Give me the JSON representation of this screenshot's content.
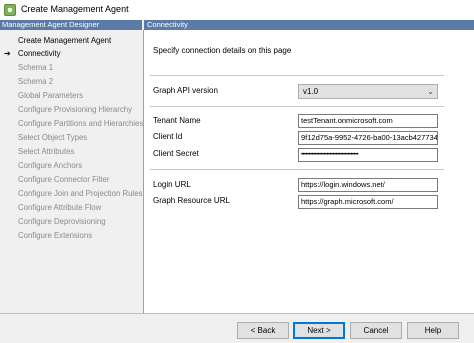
{
  "window": {
    "title": "Create Management Agent"
  },
  "sidebar": {
    "header": "Management Agent Designer",
    "items": [
      {
        "label": "Create Management Agent",
        "enabled": true,
        "current": false
      },
      {
        "label": "Connectivity",
        "enabled": true,
        "current": true
      },
      {
        "label": "Schema 1",
        "enabled": false,
        "current": false
      },
      {
        "label": "Schema 2",
        "enabled": false,
        "current": false
      },
      {
        "label": "Global Parameters",
        "enabled": false,
        "current": false
      },
      {
        "label": "Configure Provisioning Hierarchy",
        "enabled": false,
        "current": false
      },
      {
        "label": "Configure Partitions and Hierarchies",
        "enabled": false,
        "current": false
      },
      {
        "label": "Select Object Types",
        "enabled": false,
        "current": false
      },
      {
        "label": "Select Attributes",
        "enabled": false,
        "current": false
      },
      {
        "label": "Configure Anchors",
        "enabled": false,
        "current": false
      },
      {
        "label": "Configure Connector Filter",
        "enabled": false,
        "current": false
      },
      {
        "label": "Configure Join and Projection Rules",
        "enabled": false,
        "current": false
      },
      {
        "label": "Configure Attribute Flow",
        "enabled": false,
        "current": false
      },
      {
        "label": "Configure Deprovisioning",
        "enabled": false,
        "current": false
      },
      {
        "label": "Configure Extensions",
        "enabled": false,
        "current": false
      }
    ]
  },
  "main": {
    "header": "Connectivity",
    "intro": "Specify connection details on this page",
    "graph_api": {
      "label": "Graph API version",
      "value": "v1.0"
    },
    "tenant_name": {
      "label": "Tenant Name",
      "value": "testTenant.onmicrosoft.com"
    },
    "client_id": {
      "label": "Client Id",
      "value": "9f12d75a-9952-4726-ba00-13acb427734"
    },
    "client_secret": {
      "label": "Client Secret",
      "value": "••••••••••••••••••••••••••••••••••••••"
    },
    "login_url": {
      "label": "Login URL",
      "value": "https://login.windows.net/"
    },
    "graph_resource_url": {
      "label": "Graph Resource URL",
      "value": "https://graph.microsoft.com/"
    }
  },
  "buttons": {
    "back": "< Back",
    "next": "Next >",
    "cancel": "Cancel",
    "help": "Help"
  }
}
